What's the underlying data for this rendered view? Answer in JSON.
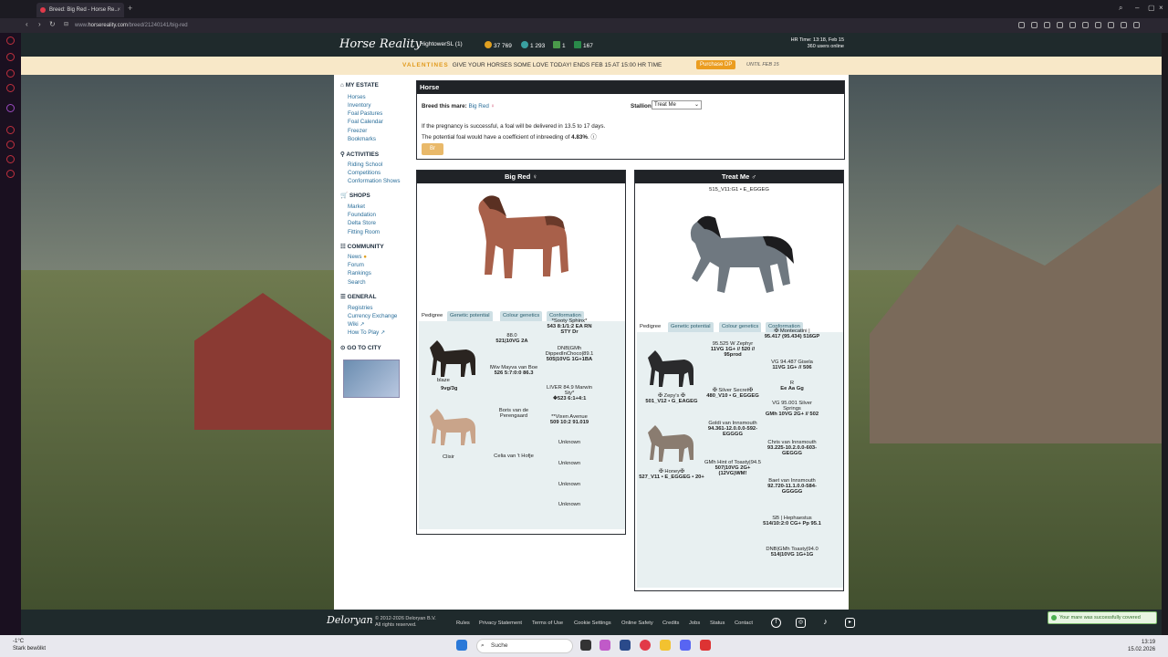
{
  "browser": {
    "tab_title": "Breed: Big Red - Horse Re...",
    "url_prefix": "www.",
    "url_domain": "horsereality.com",
    "url_path": "/breed/21240141/big-red"
  },
  "header": {
    "logo": "Horse Reality",
    "user": "HightowerSL (1)",
    "currency": [
      {
        "value": "37 769",
        "color": "#e0a020"
      },
      {
        "value": "1 293",
        "color": "#3aa0a0"
      },
      {
        "value": "1",
        "color": "#4a9a4a"
      },
      {
        "value": "167",
        "color": "#2a8a4a"
      }
    ],
    "hr_time": "HR Time: 13:18, Feb 15",
    "users_online": "360 users online"
  },
  "promo": {
    "title": "VALENTINES",
    "text": "GIVE YOUR HORSES SOME LOVE TODAY! ENDS FEB 15 AT 15:00 HR TIME",
    "button": "Purchase DP",
    "until": "UNTIL FEB 15"
  },
  "sidebar": {
    "my_estate": "MY ESTATE",
    "estate_items": [
      "Horses",
      "Inventory",
      "Foal Pastures",
      "Foal Calendar",
      "Freezer",
      "Bookmarks"
    ],
    "activities": "ACTIVITIES",
    "activity_items": [
      "Riding School",
      "Competitions",
      "Conformation Shows"
    ],
    "shops": "SHOPS",
    "shop_items": [
      "Market",
      "Foundation",
      "Delta Store",
      "Fitting Room"
    ],
    "community": "COMMUNITY",
    "community_items": [
      "News",
      "Forum",
      "Rankings",
      "Search"
    ],
    "general": "GENERAL",
    "general_items": [
      "Registries",
      "Currency Exchange",
      "Wiki",
      "How To Play"
    ],
    "go_to_city": "GO TO CITY"
  },
  "breed": {
    "title": "Horse",
    "breed_label": "Breed this mare:",
    "mare_name": "Big Red",
    "stallion_label": "Stallion",
    "stallion_value": "Treat Me",
    "info_line1": "If the pregnancy is successful, a foal will be delivered in 13.5 to 17 days.",
    "info_line2": "The potential foal would have a coefficient of inbreeding of",
    "inbreeding": "4.83%",
    "button": "Br"
  },
  "mare": {
    "name": "Big Red",
    "tabs": [
      "Pedigree",
      "Genetic potential",
      "Colour genetics",
      "Conformation"
    ],
    "pedigree": {
      "sire": "blaze",
      "sire_stats": "9vg/3g",
      "dam": "Clisir",
      "gen2": [
        {
          "name": "88.0",
          "stats": "521|10VG 2A"
        },
        {
          "name": "lWw Mayva van Boe",
          "stats": "526 5:7:0:0 86.3"
        },
        {
          "name": "Boris van de Perengaard",
          "stats": ""
        },
        {
          "name": "Celia van 't Hofje",
          "stats": ""
        }
      ],
      "gen3": [
        {
          "name": "*Sooty Sphinx*",
          "stats": "543 8:1/1:2 EA RN STY Dr"
        },
        {
          "name": "DNB|GMh DippedInChoco|89.1",
          "stats": "505|10VG 1G+1BA"
        },
        {
          "name": "LIVER 84.9 Marwin Sty*",
          "stats": "❖523 6:1+4:1"
        },
        {
          "name": "**Vixen Avenue",
          "stats": "509 10:2 91.019"
        },
        {
          "name": "Unknown",
          "stats": ""
        },
        {
          "name": "Unknown",
          "stats": ""
        },
        {
          "name": "Unknown",
          "stats": ""
        },
        {
          "name": "Unknown",
          "stats": ""
        }
      ]
    }
  },
  "stallion": {
    "name": "Treat Me",
    "code": "515_V11:G1 • E_EGGEG",
    "tabs": [
      "Pedigree",
      "Genetic potential",
      "Colour genetics",
      "Conformation"
    ],
    "pedigree": {
      "sire": "✠ Zepy's ✠",
      "sire_stats": "501_V12 • G_EAGEG",
      "dam": "✠ Honey✠",
      "dam_stats": "527_V11 • E_EGGEG • 20+",
      "gen2": [
        {
          "name": "95.525 W Zephyr",
          "stats": "11VG 1G+ // 520 // 95prod"
        },
        {
          "name": "✠ Silver Secret✠",
          "stats": "480_V10 • G_EGGEG"
        },
        {
          "name": "Goldi van Innsmouth",
          "stats": "94.361-12.0.0.0-592-EGGGG"
        },
        {
          "name": "GMh Hint of Toasty|94.5",
          "stats": "507|10VG 2G+ (12VG)WM!"
        }
      ],
      "gen3": [
        {
          "name": "✠ Montecatini |",
          "stats": "95.417 (95.434) 516GP"
        },
        {
          "name": "VG 94.487 Gisela",
          "stats": "11VG 1G+ // 506"
        },
        {
          "name": "R",
          "stats": "Ee Aa Gg"
        },
        {
          "name": "VG 95.001 Silver Springs",
          "stats": "GMh 10VG 2G+ // 502"
        },
        {
          "name": "Chris van Innsmouth",
          "stats": "93.225-10.2.0.0-603-GEGGG"
        },
        {
          "name": "Baet van Innsmouth",
          "stats": "92.720-11.1.0.0-584-GGGGG"
        },
        {
          "name": "SB | Hephaestus",
          "stats": "514/10:2:0 CG+ Pp 95.1"
        },
        {
          "name": "DNB|GMh Toasty|94.0",
          "stats": "514|10VG 1G+1G"
        }
      ]
    }
  },
  "footer": {
    "logo": "Deloryan",
    "copy1": "© 2012-2026 Deloryan B.V.",
    "copy2": "All rights reserved.",
    "links": [
      "Rules",
      "Privacy Statement",
      "Terms of Use",
      "Cookie Settings",
      "Online Safety",
      "Credits",
      "Jobs",
      "Status",
      "Contact"
    ]
  },
  "toast": "Your mare was successfully covered",
  "taskbar": {
    "temp": "-1°C",
    "weather": "Stark bewölkt",
    "search": "Suche",
    "time": "13:19",
    "date": "15.02.2026"
  }
}
